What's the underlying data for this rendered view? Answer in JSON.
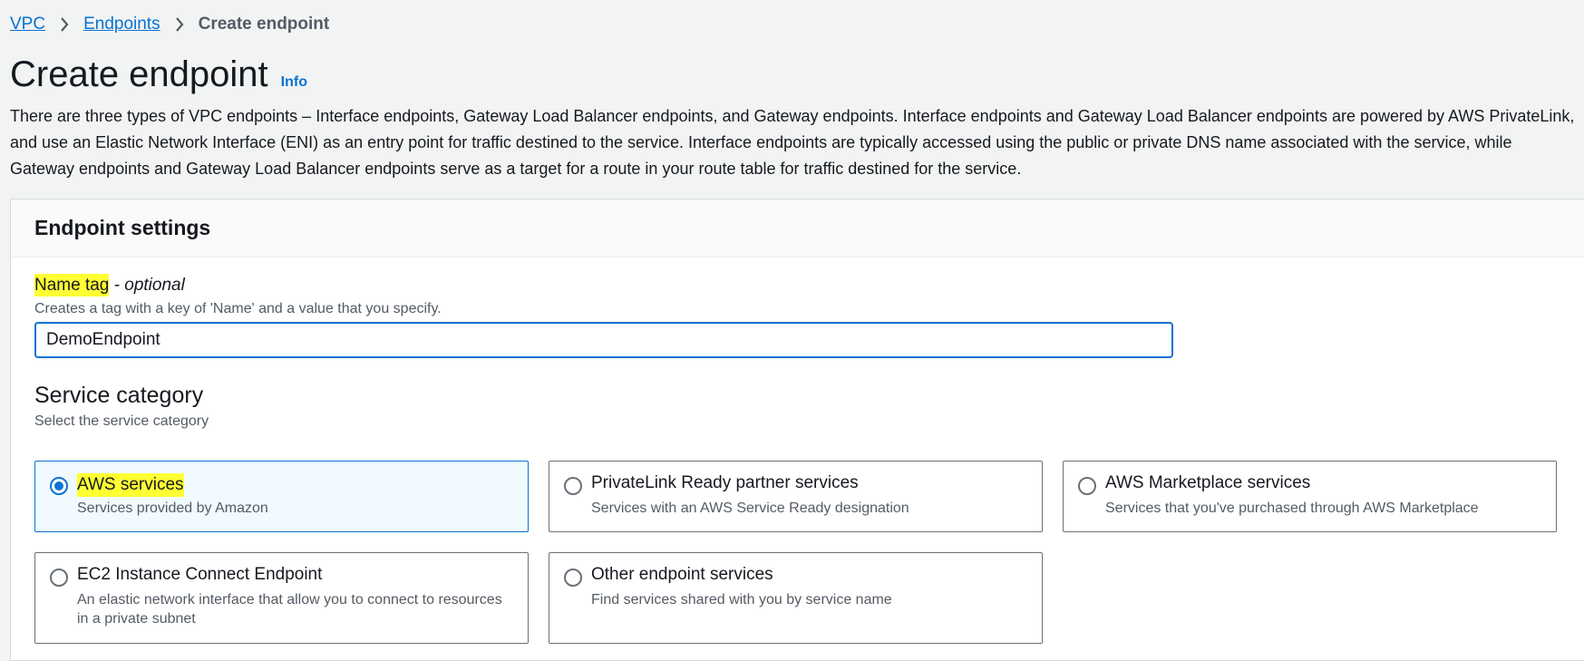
{
  "breadcrumb": {
    "items": [
      "VPC",
      "Endpoints"
    ],
    "current": "Create endpoint"
  },
  "page": {
    "title": "Create endpoint",
    "info_label": "Info",
    "description": "There are three types of VPC endpoints – Interface endpoints, Gateway Load Balancer endpoints, and Gateway endpoints. Interface endpoints and Gateway Load Balancer endpoints are powered by AWS PrivateLink, and use an Elastic Network Interface (ENI) as an entry point for traffic destined to the service. Interface endpoints are typically accessed using the public or private DNS name associated with the service, while Gateway endpoints and Gateway Load Balancer endpoints serve as a target for a route in your route table for traffic destined for the service."
  },
  "settings": {
    "title": "Endpoint settings",
    "name_tag": {
      "label": "Name tag",
      "optional": "- optional",
      "hint": "Creates a tag with a key of 'Name' and a value that you specify.",
      "value": "DemoEndpoint"
    },
    "service_category": {
      "heading": "Service category",
      "hint": "Select the service category",
      "selected": "AWS services",
      "options": [
        {
          "label": "AWS services",
          "description": "Services provided by Amazon"
        },
        {
          "label": "PrivateLink Ready partner services",
          "description": "Services with an AWS Service Ready designation"
        },
        {
          "label": "AWS Marketplace services",
          "description": "Services that you've purchased through AWS Marketplace"
        },
        {
          "label": "EC2 Instance Connect Endpoint",
          "description": "An elastic network interface that allow you to connect to resources in a private subnet"
        },
        {
          "label": "Other endpoint services",
          "description": "Find services shared with you by service name"
        }
      ]
    }
  },
  "colors": {
    "accent": "#0972d3",
    "highlight": "#ffff33",
    "background": "#f2f3f3"
  },
  "icons": {
    "breadcrumb_separator": "chevron-right-icon"
  }
}
